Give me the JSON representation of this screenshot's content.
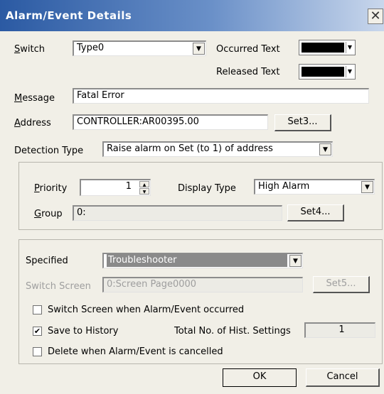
{
  "title": "Alarm/Event Details",
  "close_glyph": "✕",
  "switch": {
    "label": "Switch",
    "value": "Type0"
  },
  "occurred_text": {
    "label": "Occurred Text",
    "color": "#000000"
  },
  "released_text": {
    "label": "Released Text",
    "color": "#000000"
  },
  "message": {
    "label": "Message",
    "value": "Fatal Error"
  },
  "address": {
    "label": "Address",
    "value": "CONTROLLER:AR00395.00",
    "set_button": "Set3..."
  },
  "detection_type": {
    "label": "Detection Type",
    "value": "Raise alarm on Set (to 1) of address"
  },
  "priority": {
    "label": "Priority",
    "value": "1"
  },
  "display_type": {
    "label": "Display Type",
    "value": "High Alarm"
  },
  "group": {
    "label": "Group",
    "value": "0:",
    "set_button": "Set4..."
  },
  "specified": {
    "label": "Specified",
    "value": "Troubleshooter"
  },
  "switch_screen": {
    "label": "Switch Screen",
    "value": "0:Screen Page0000",
    "set_button": "Set5..."
  },
  "options": {
    "switch_screen_on_alarm": {
      "label": "Switch Screen when Alarm/Event occurred",
      "checked": false
    },
    "save_to_history": {
      "label": "Save to History",
      "checked": true
    },
    "delete_when_cancelled": {
      "label": "Delete when Alarm/Event is cancelled",
      "checked": false
    }
  },
  "history_settings": {
    "label": "Total No. of Hist. Settings",
    "value": "1"
  },
  "buttons": {
    "ok": "OK",
    "cancel": "Cancel"
  },
  "glyphs": {
    "dropdown": "▼",
    "spin_up": "▲",
    "spin_down": "▼",
    "check": "✔"
  }
}
